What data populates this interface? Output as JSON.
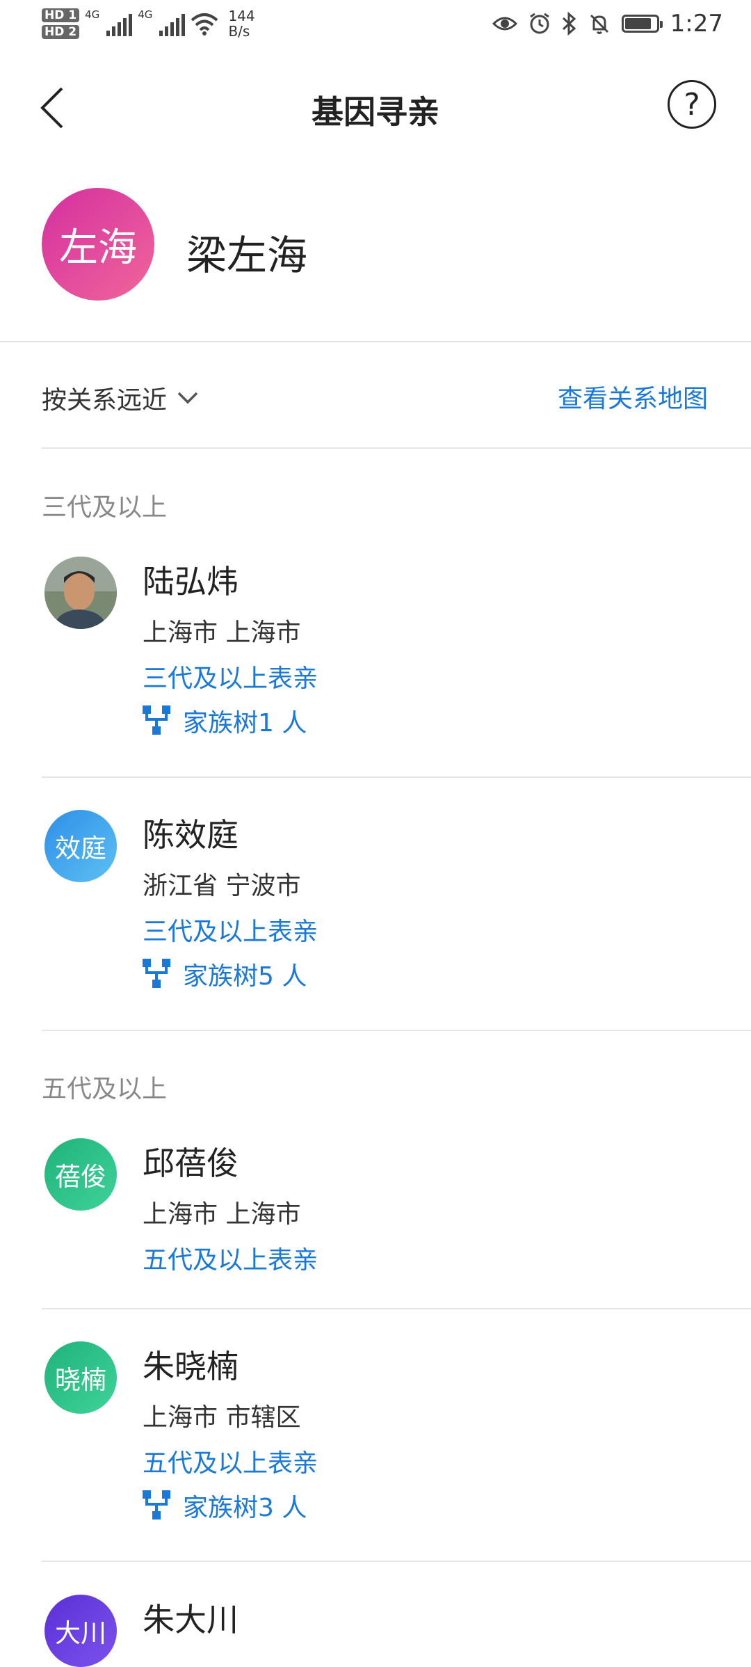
{
  "status_bar": {
    "hd1": "HD 1",
    "hd2": "HD 2",
    "net1": "4G",
    "net2": "4G",
    "speed_value": "144",
    "speed_unit": "B/s",
    "icons": [
      "eye-icon",
      "alarm-icon",
      "bluetooth-icon",
      "mute-icon"
    ],
    "battery_level": 0.85,
    "time": "1:27"
  },
  "nav": {
    "title": "基因寻亲",
    "help": "?"
  },
  "profile": {
    "avatar_text": "左海",
    "name": "梁左海"
  },
  "filter": {
    "sort_label": "按关系远近",
    "map_link": "查看关系地图"
  },
  "sections": [
    {
      "title": "三代及以上",
      "items": [
        {
          "name": "陆弘炜",
          "avatar_text": "",
          "avatar_type": "photo",
          "location": "上海市 上海市",
          "relation": "三代及以上表亲",
          "tree": "家族树1 人"
        },
        {
          "name": "陈效庭",
          "avatar_text": "效庭",
          "avatar_color": "#3aa3ec",
          "location": "浙江省 宁波市",
          "relation": "三代及以上表亲",
          "tree": "家族树5 人"
        }
      ]
    },
    {
      "title": "五代及以上",
      "items": [
        {
          "name": "邱蓓俊",
          "avatar_text": "蓓俊",
          "avatar_color": "#28c07e",
          "location": "上海市 上海市",
          "relation": "五代及以上表亲",
          "tree": ""
        },
        {
          "name": "朱晓楠",
          "avatar_text": "晓楠",
          "avatar_color": "#28c07e",
          "location": "上海市 市辖区",
          "relation": "五代及以上表亲",
          "tree": "家族树3 人"
        },
        {
          "name": "朱大川",
          "avatar_text": "大川",
          "avatar_color": "#6a3ee0",
          "location": "",
          "relation": "",
          "tree": ""
        }
      ]
    }
  ],
  "colors": {
    "accent": "#1a78d6",
    "profile_gradient": [
      "#d42fa0",
      "#f0669a"
    ]
  }
}
